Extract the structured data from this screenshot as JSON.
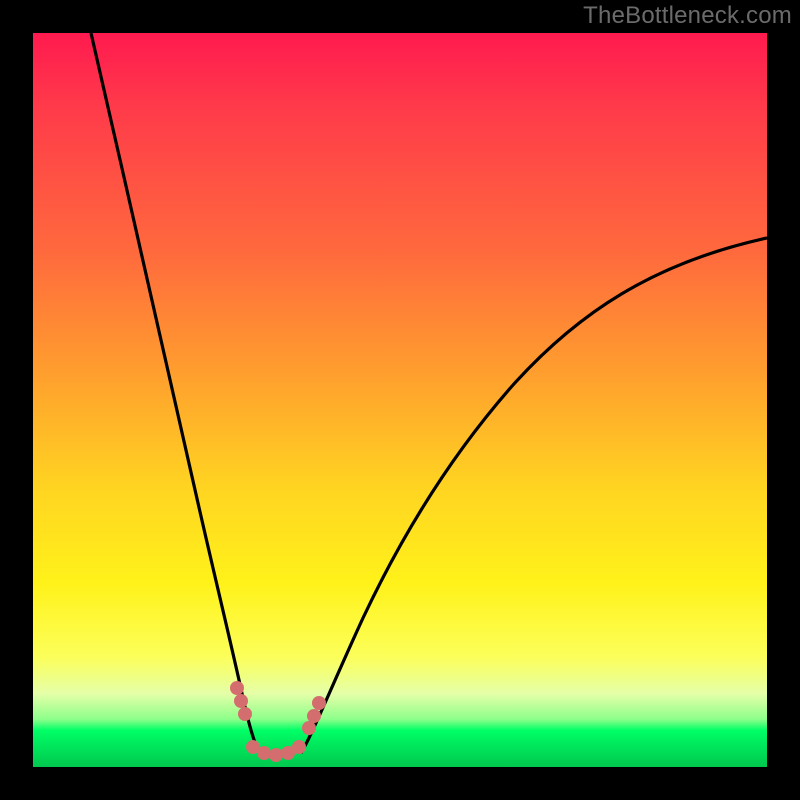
{
  "watermark": "TheBottleneck.com",
  "chart_data": {
    "type": "line",
    "title": "",
    "xlabel": "",
    "ylabel": "",
    "xlim": [
      0,
      100
    ],
    "ylim": [
      0,
      100
    ],
    "grid": false,
    "legend": false,
    "series": [
      {
        "name": "left-arm",
        "x": [
          8,
          10,
          12,
          14,
          16,
          18,
          20,
          22,
          24,
          25,
          26,
          27,
          28,
          29,
          30
        ],
        "y": [
          100,
          88,
          76,
          65,
          54,
          44,
          34,
          25,
          16,
          12,
          9,
          6.5,
          4.5,
          3,
          2
        ]
      },
      {
        "name": "right-arm",
        "x": [
          36,
          38,
          40,
          44,
          48,
          52,
          56,
          60,
          66,
          72,
          78,
          84,
          90,
          96,
          100
        ],
        "y": [
          2,
          4,
          7,
          13,
          19,
          25,
          31,
          36,
          43,
          49,
          54,
          58.5,
          62.5,
          66,
          68
        ]
      },
      {
        "name": "trough-dotted",
        "x": [
          27,
          28.5,
          30,
          31.5,
          33,
          34.5,
          36,
          37.5,
          38.5
        ],
        "y": [
          7,
          4.5,
          2.8,
          1.8,
          1.5,
          1.8,
          2.8,
          4.5,
          7
        ]
      }
    ],
    "annotations": [],
    "colors": {
      "curve": "#000000",
      "dots": "#d16a6a",
      "gradient_top": "#ff1a4f",
      "gradient_mid": "#fff21a",
      "gradient_bottom": "#00c84e"
    }
  }
}
